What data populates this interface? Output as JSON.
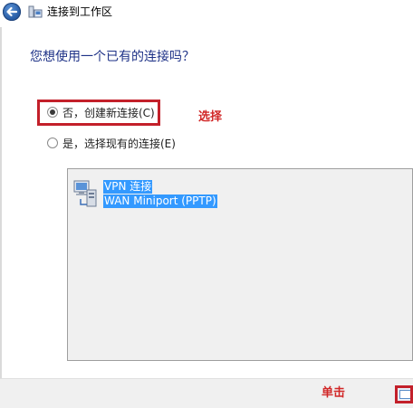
{
  "window": {
    "title": "连接到工作区"
  },
  "question": "您想使用一个已有的连接吗？",
  "options": [
    {
      "label": "否，创建新连接(C)",
      "selected": true
    },
    {
      "label": "是，选择现有的连接(E)",
      "selected": false
    }
  ],
  "connections": [
    {
      "name": "VPN 连接",
      "device": "WAN Miniport (PPTP)"
    }
  ],
  "annotations": {
    "select_label": "选择",
    "click_label": "单击"
  },
  "colors": {
    "accent": "#c3202a",
    "question": "#1e3287",
    "selection": "#3399ff"
  },
  "icons": {
    "back": "back-arrow-icon",
    "title": "network-wizard-icon",
    "connection": "vpn-connection-icon"
  }
}
